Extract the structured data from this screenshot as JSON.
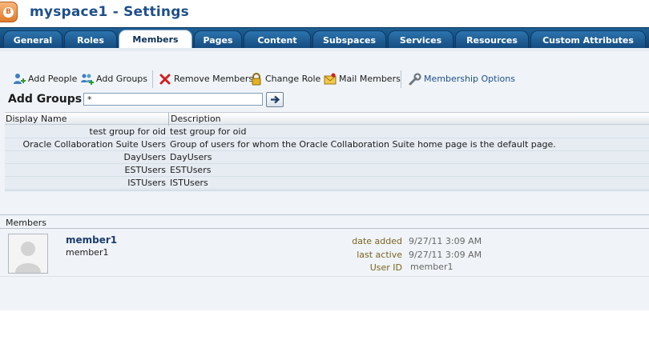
{
  "window": {
    "title": "myspace1 - Settings"
  },
  "tabs": [
    {
      "label": "General",
      "active": false
    },
    {
      "label": "Roles",
      "active": false
    },
    {
      "label": "Members",
      "active": true
    },
    {
      "label": "Pages",
      "active": false
    },
    {
      "label": "Content",
      "active": false
    },
    {
      "label": "Subspaces",
      "active": false
    },
    {
      "label": "Services",
      "active": false
    },
    {
      "label": "Resources",
      "active": false
    },
    {
      "label": "Custom Attributes",
      "active": false
    }
  ],
  "toolbar": {
    "add_people": "Add People",
    "add_groups": "Add Groups",
    "remove_members": "Remove Members",
    "change_role": "Change Role",
    "mail_members": "Mail Members",
    "membership_options": "Membership Options"
  },
  "search": {
    "label": "Add Groups",
    "value": "*"
  },
  "table": {
    "columns": [
      "Display Name",
      "Description"
    ],
    "rows": [
      {
        "name": "test group for oid",
        "description": "test group for oid"
      },
      {
        "name": "Oracle Collaboration Suite Users",
        "description": "Group of users for whom the Oracle Collaboration Suite home page is the default page."
      },
      {
        "name": "DayUsers",
        "description": "DayUsers"
      },
      {
        "name": "ESTUsers",
        "description": "ESTUsers"
      },
      {
        "name": "ISTUsers",
        "description": "ISTUsers"
      }
    ]
  },
  "members": {
    "label": "Members",
    "list": [
      {
        "name": "member1",
        "username": "member1",
        "date_added_label": "date added",
        "date_added": "9/27/11 3:09 AM",
        "last_active_label": "last active",
        "last_active": "9/27/11 3:09 AM",
        "user_id_label": "User ID",
        "user_id": "member1"
      }
    ]
  },
  "colors": {
    "tab_bar": "#0f3e6d",
    "title": "#1f4f8a",
    "panel": "#f0f4f8",
    "member_name": "#1d3d6b"
  },
  "icons": {
    "app": "orange-app-logo-icon",
    "add_people": "add-person-icon",
    "add_groups": "add-group-icon",
    "remove_members": "red-x-icon",
    "change_role": "padlock-icon",
    "mail_members": "envelope-icon",
    "membership_options": "wrench-icon",
    "go": "arrow-right-icon",
    "avatar": "default-avatar-icon"
  }
}
